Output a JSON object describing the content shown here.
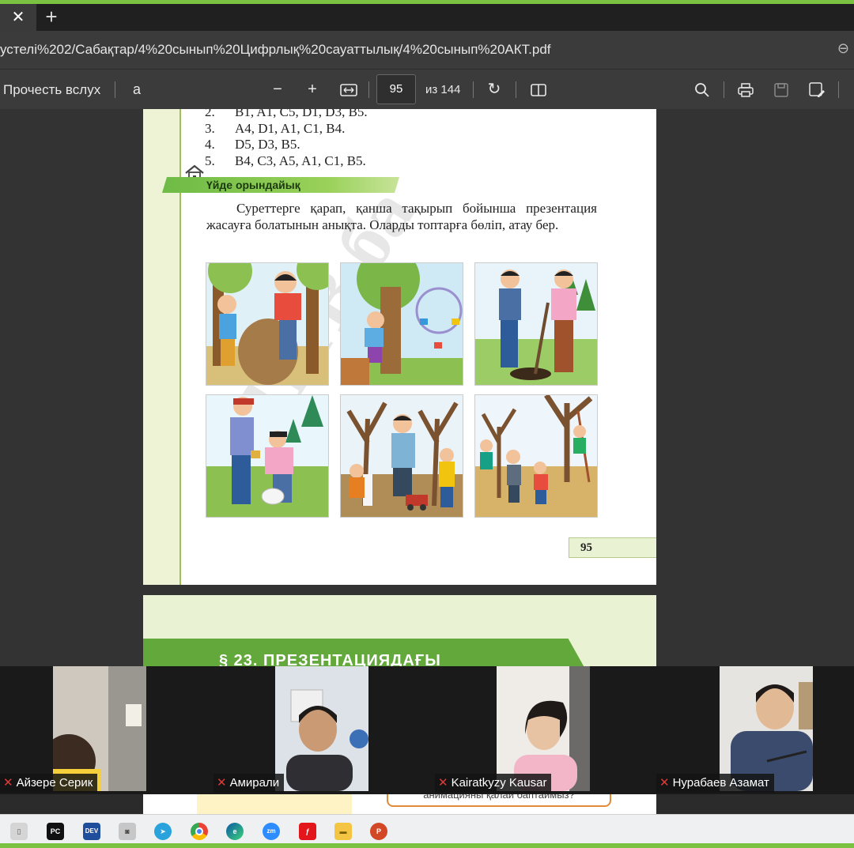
{
  "browser": {
    "tab_close": "✕",
    "tab_new": "+",
    "url": "устелі%202/Сабақтар/4%20сынып%20Цифрлық%20сауаттылық/4%20сынып%20АКТ.pdf"
  },
  "pdf_toolbar": {
    "read_aloud": "Прочесть вслух",
    "current_page": "95",
    "total_pages": "из 144"
  },
  "document": {
    "answers": [
      {
        "num": "2.",
        "text": "B1, A1, C5, D1, D3, B5."
      },
      {
        "num": "3.",
        "text": "A4, D1, A1, C1, B4."
      },
      {
        "num": "4.",
        "text": "D5, D3, B5."
      },
      {
        "num": "5.",
        "text": "B4, C3, A5, A1, C1, B5."
      }
    ],
    "homework_heading": "Үйде орындайық",
    "task_text": "Суреттерге қарап, қанша тақырып бойынша презентация жасауға болатынын анықта. Оларды топтарға бөліп, атау бер.",
    "page_number": "95",
    "watermark": "АПТВ ба",
    "next_section_title": "§ 23. ПРЕЗЕНТАЦИЯДАҒЫ",
    "next_page_bubble": "анимацияны қалай баптаймыз?"
  },
  "participants": [
    {
      "name": "Айзере Серик"
    },
    {
      "name": "Амирали"
    },
    {
      "name": "Kairatkyzy  Kausar"
    },
    {
      "name": "Нурабаев Азамат"
    }
  ],
  "taskbar": {
    "apps": [
      "pc-icon",
      "devc-icon",
      "camera-icon",
      "telegram-icon",
      "chrome-icon",
      "edge-icon",
      "zoom-icon",
      "acrobat-icon",
      "explorer-icon",
      "powerpoint-icon"
    ],
    "labels": {
      "pc": "PC",
      "dev": "DEV",
      "zm": "zm"
    }
  },
  "colors": {
    "accent_green": "#7cc242",
    "ribbon_green": "#6dbb45",
    "mic_red": "#e53935"
  }
}
